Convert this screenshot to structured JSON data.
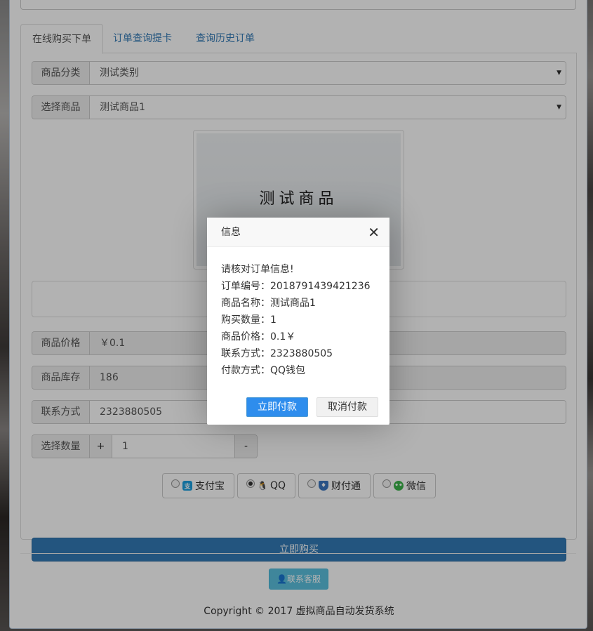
{
  "tabs": [
    {
      "label": "在线购买下单"
    },
    {
      "label": "订单查询提卡"
    },
    {
      "label": "查询历史订单"
    }
  ],
  "form": {
    "category_label": "商品分类",
    "category_value": "测试类别",
    "product_label": "选择商品",
    "product_value": "测试商品1",
    "image_text": "测试商品",
    "price_label": "商品价格",
    "price_value": "￥0.1",
    "stock_label": "商品库存",
    "stock_value": "186",
    "contact_label": "联系方式",
    "contact_value": "2323880505",
    "qty_label": "选择数量",
    "qty_plus": "+",
    "qty_value": "1",
    "qty_minus": "-"
  },
  "payment": {
    "options": [
      {
        "label": "支付宝",
        "icon": "alipay-icon",
        "color": "#1a9fe0",
        "selected": false
      },
      {
        "label": "QQ",
        "icon": "qq-penguin-icon",
        "color": "#000000",
        "selected": true
      },
      {
        "label": "财付通",
        "icon": "tenpay-shield-icon",
        "color": "#3b76c0",
        "selected": false
      },
      {
        "label": "微信",
        "icon": "wechat-icon",
        "color": "#3bb34a",
        "selected": false
      }
    ]
  },
  "buy_button": "立即购买",
  "service_button": "联系客服",
  "copyright": "Copyright © 2017 虚拟商品自动发货系统",
  "modal": {
    "title": "信息",
    "close": "✕",
    "lines": [
      "请核对订单信息!",
      "订单编号：2018791439421236",
      "商品名称：测试商品1",
      "购买数量：1",
      "商品价格：0.1￥",
      "联系方式：2323880505",
      "付款方式：QQ钱包"
    ],
    "confirm": "立即付款",
    "cancel": "取消付款"
  },
  "colors": {
    "primary": "#337ab7",
    "info": "#5bc0de",
    "modal_primary": "#2e8ded"
  }
}
